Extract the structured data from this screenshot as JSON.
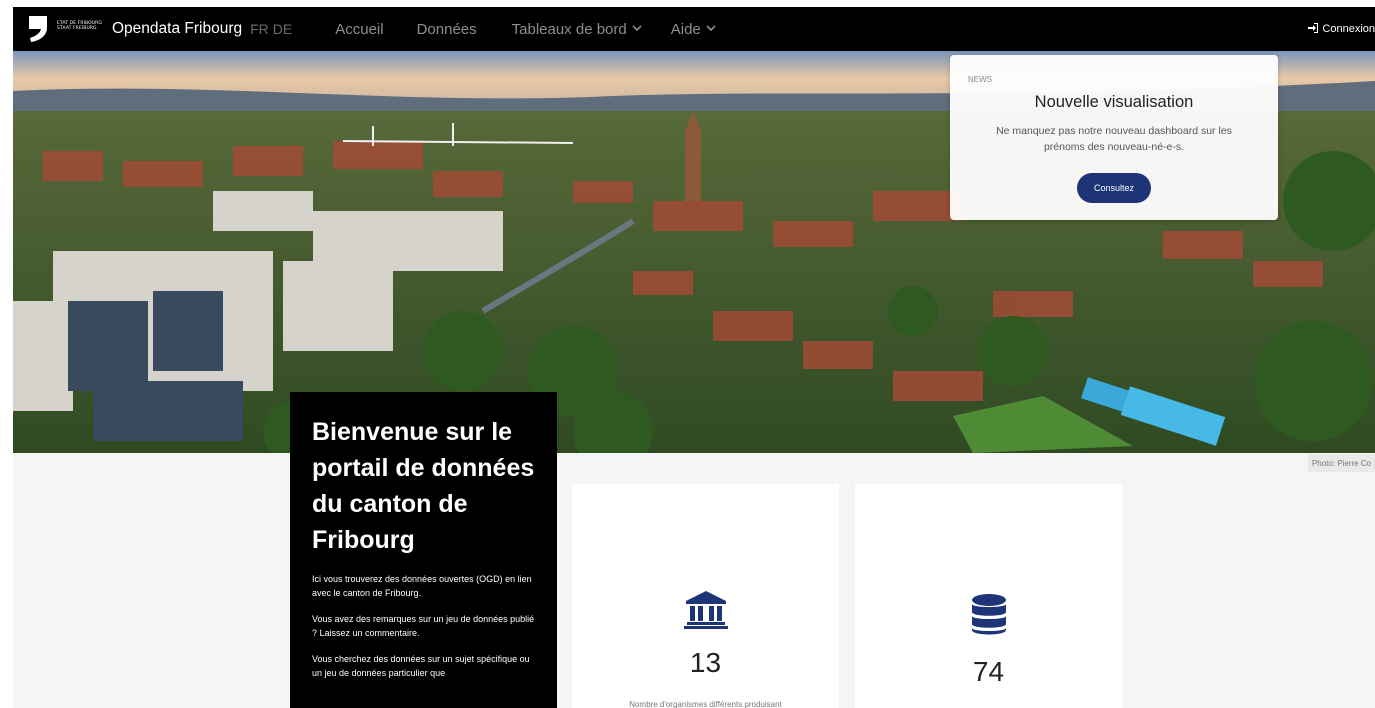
{
  "nav": {
    "logo_line1": "ETAT DE FRIBOURG",
    "logo_line2": "STAAT FREIBURG",
    "brand": "Opendata Fribourg",
    "lang_fr": "FR",
    "lang_de": "DE",
    "items": [
      {
        "label": "Accueil"
      },
      {
        "label": "Données"
      },
      {
        "label": "Tableaux de bord",
        "dropdown": true
      },
      {
        "label": "Aide",
        "dropdown": true
      }
    ],
    "login": "Connexion"
  },
  "news": {
    "tag": "NEWS",
    "title": "Nouvelle visualisation",
    "text": "Ne manquez pas notre nouveau dashboard sur les prénoms des nouveau-né-e-s.",
    "button": "Consultez"
  },
  "hero": {
    "credit": "Photo: Pierre Co"
  },
  "welcome": {
    "title": "Bienvenue sur le portail de données du canton de Fribourg",
    "p1": "Ici vous trouverez des données ouvertes (OGD) en lien avec le canton de Fribourg.",
    "p2": "Vous avez des remarques sur un jeu de données publié ? Laissez un commentaire.",
    "p3": "Vous cherchez des données sur un sujet spécifique ou un jeu de données particulier que"
  },
  "stats": [
    {
      "icon": "institution-icon",
      "value": "13",
      "label": "Nombre d'organismes différents produisant"
    },
    {
      "icon": "database-icon",
      "value": "74",
      "label": ""
    }
  ],
  "colors": {
    "nav_bg": "#000000",
    "accent": "#1d3576",
    "icon_color": "#1d3576"
  }
}
